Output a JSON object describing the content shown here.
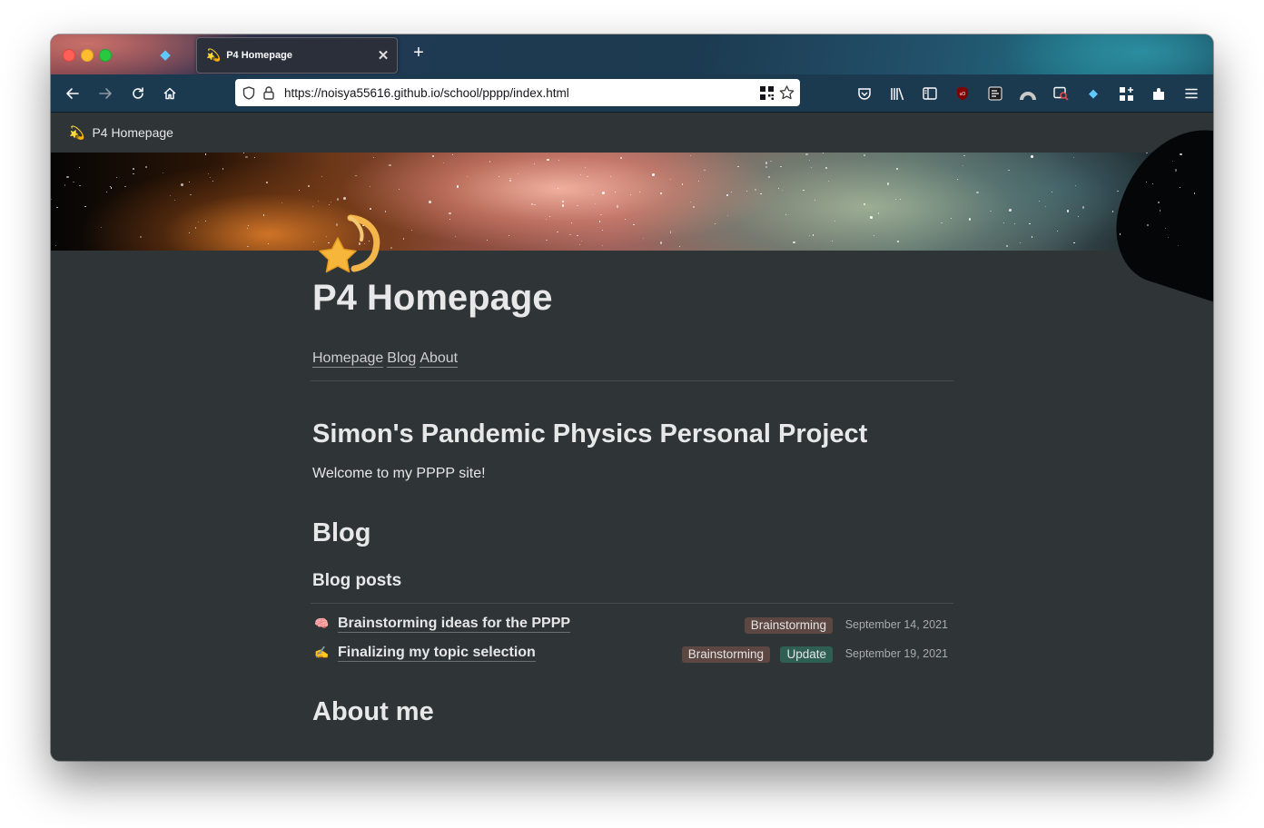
{
  "browser": {
    "tab": {
      "title": "P4 Homepage",
      "favicon": "shooting-star-icon"
    },
    "url": "https://noisya55616.github.io/school/pppp/index.html"
  },
  "page": {
    "topbar_title": "P4 Homepage",
    "title": "P4 Homepage",
    "nav_links": [
      "Homepage",
      "Blog",
      "About"
    ],
    "heading": "Simon's Pandemic Physics Personal Project",
    "welcome": "Welcome to my PPPP site!",
    "blog_heading": "Blog",
    "blog_posts_heading": "Blog posts",
    "posts": [
      {
        "icon": "🧠",
        "title": "Brainstorming ideas for the PPPP",
        "tags": [
          "Brainstorming"
        ],
        "date": "September 14, 2021"
      },
      {
        "icon": "✍️",
        "title": "Finalizing my topic selection",
        "tags": [
          "Brainstorming",
          "Update"
        ],
        "date": "September 19, 2021"
      }
    ],
    "about_heading": "About me"
  },
  "colors": {
    "page_bg": "#2f3437",
    "tag_brainstorming": "#5c4742",
    "tag_update": "#2f5e52"
  }
}
